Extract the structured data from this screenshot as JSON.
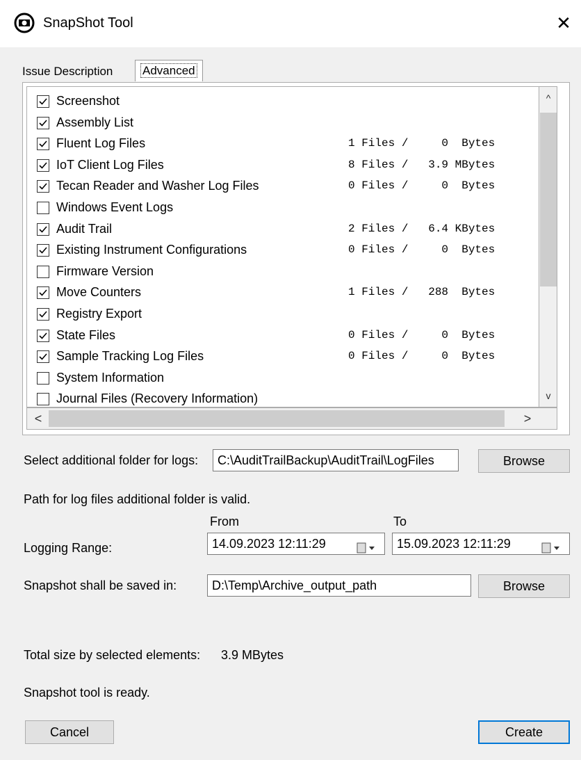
{
  "window": {
    "title": "SnapShot Tool",
    "close_label": "✕"
  },
  "tabs": [
    {
      "label": "Issue Description"
    },
    {
      "label": "Advanced"
    }
  ],
  "items": [
    {
      "label": "Screenshot",
      "checked": true,
      "info": ""
    },
    {
      "label": "Assembly List",
      "checked": true,
      "info": ""
    },
    {
      "label": "Fluent Log Files",
      "checked": true,
      "info": "1 Files /     0  Bytes"
    },
    {
      "label": "IoT Client Log Files",
      "checked": true,
      "info": "8 Files /   3.9 MBytes"
    },
    {
      "label": "Tecan Reader and Washer Log Files",
      "checked": true,
      "info": "0 Files /     0  Bytes"
    },
    {
      "label": "Windows Event Logs",
      "checked": false,
      "info": ""
    },
    {
      "label": "Audit Trail",
      "checked": true,
      "info": "2 Files /   6.4 KBytes"
    },
    {
      "label": "Existing Instrument Configurations",
      "checked": true,
      "info": "0 Files /     0  Bytes"
    },
    {
      "label": "Firmware Version",
      "checked": false,
      "info": ""
    },
    {
      "label": "Move Counters",
      "checked": true,
      "info": "1 Files /   288  Bytes"
    },
    {
      "label": "Registry Export",
      "checked": true,
      "info": ""
    },
    {
      "label": "State Files",
      "checked": true,
      "info": "0 Files /     0  Bytes"
    },
    {
      "label": "Sample Tracking Log Files",
      "checked": true,
      "info": "0 Files /     0  Bytes"
    },
    {
      "label": "System Information",
      "checked": false,
      "info": ""
    },
    {
      "label": "Journal Files (Recovery Information)",
      "checked": false,
      "info": ""
    }
  ],
  "scroll": {
    "up": "^",
    "down": "v",
    "left": "<",
    "right": ">"
  },
  "additional_folder": {
    "label": "Select additional folder for logs:",
    "value": "C:\\AuditTrailBackup\\AuditTrail\\LogFiles",
    "browse_label": "Browse"
  },
  "path_status": "Path for log files additional folder is valid.",
  "logging": {
    "label": "Logging Range:",
    "from_label": "From",
    "to_label": "To",
    "from_value": "14.09.2023 12:11:29",
    "to_value": "15.09.2023 12:11:29"
  },
  "save": {
    "label": "Snapshot shall be saved in:",
    "value": "D:\\Temp\\Archive_output_path",
    "browse_label": "Browse"
  },
  "total": {
    "label": "Total size by selected elements:",
    "value": "3.9 MBytes"
  },
  "status": "Snapshot tool is ready.",
  "buttons": {
    "cancel": "Cancel",
    "create": "Create"
  }
}
